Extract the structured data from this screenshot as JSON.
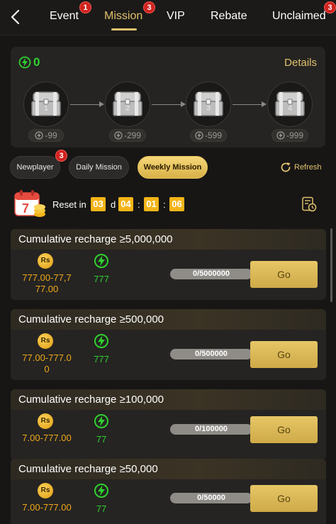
{
  "header": {
    "tabs": [
      {
        "label": "Event",
        "badge": "1"
      },
      {
        "label": "Mission",
        "badge": "3",
        "active": true
      },
      {
        "label": "VIP"
      },
      {
        "label": "Rebate"
      },
      {
        "label": "Unclaimed",
        "badge": "3"
      }
    ]
  },
  "progress": {
    "energy_total": "0",
    "details_label": "Details",
    "chests": [
      {
        "number": "1",
        "cost": "-99"
      },
      {
        "number": "2",
        "cost": "-299"
      },
      {
        "number": "3",
        "cost": "-599"
      },
      {
        "number": "4",
        "cost": "-999"
      }
    ]
  },
  "mission_tabs": [
    {
      "label": "Newplayer",
      "badge": "3"
    },
    {
      "label": "Daily Mission"
    },
    {
      "label": "Weekly Mission",
      "active": true
    }
  ],
  "refresh_label": "Refresh",
  "reset": {
    "label": "Reset in",
    "days": "03",
    "day_unit": "d",
    "hours": "04",
    "minutes": "01",
    "seconds": "06",
    "sep": ":"
  },
  "missions": [
    {
      "title": "Cumulative recharge ≥5,000,000",
      "rs_label": "Rs",
      "rs_line1": "777.00-77,7",
      "rs_line2": "77.00",
      "energy": "777",
      "progress_text": "0/5000000",
      "progress_fraction": 0,
      "go_label": "Go"
    },
    {
      "title": "Cumulative recharge ≥500,000",
      "rs_label": "Rs",
      "rs_line1": "77.00-777.0",
      "rs_line2": "0",
      "energy": "777",
      "progress_text": "0/500000",
      "progress_fraction": 0,
      "go_label": "Go"
    },
    {
      "title": "Cumulative recharge ≥100,000",
      "rs_label": "Rs",
      "rs_line1": "7.00-777.00",
      "rs_line2": "",
      "energy": "77",
      "progress_text": "0/100000",
      "progress_fraction": 0,
      "go_label": "Go"
    },
    {
      "title": "Cumulative recharge ≥50,000",
      "rs_label": "Rs",
      "rs_line1": "7.00-777.00",
      "rs_line2": "",
      "energy": "77",
      "progress_text": "0/50000",
      "progress_fraction": 0,
      "go_label": "Go"
    }
  ],
  "colors": {
    "accent_gold": "#e2c16d",
    "energy_green": "#2fd12f",
    "badge_red": "#d0221f",
    "timer_orange": "#f3b418"
  }
}
